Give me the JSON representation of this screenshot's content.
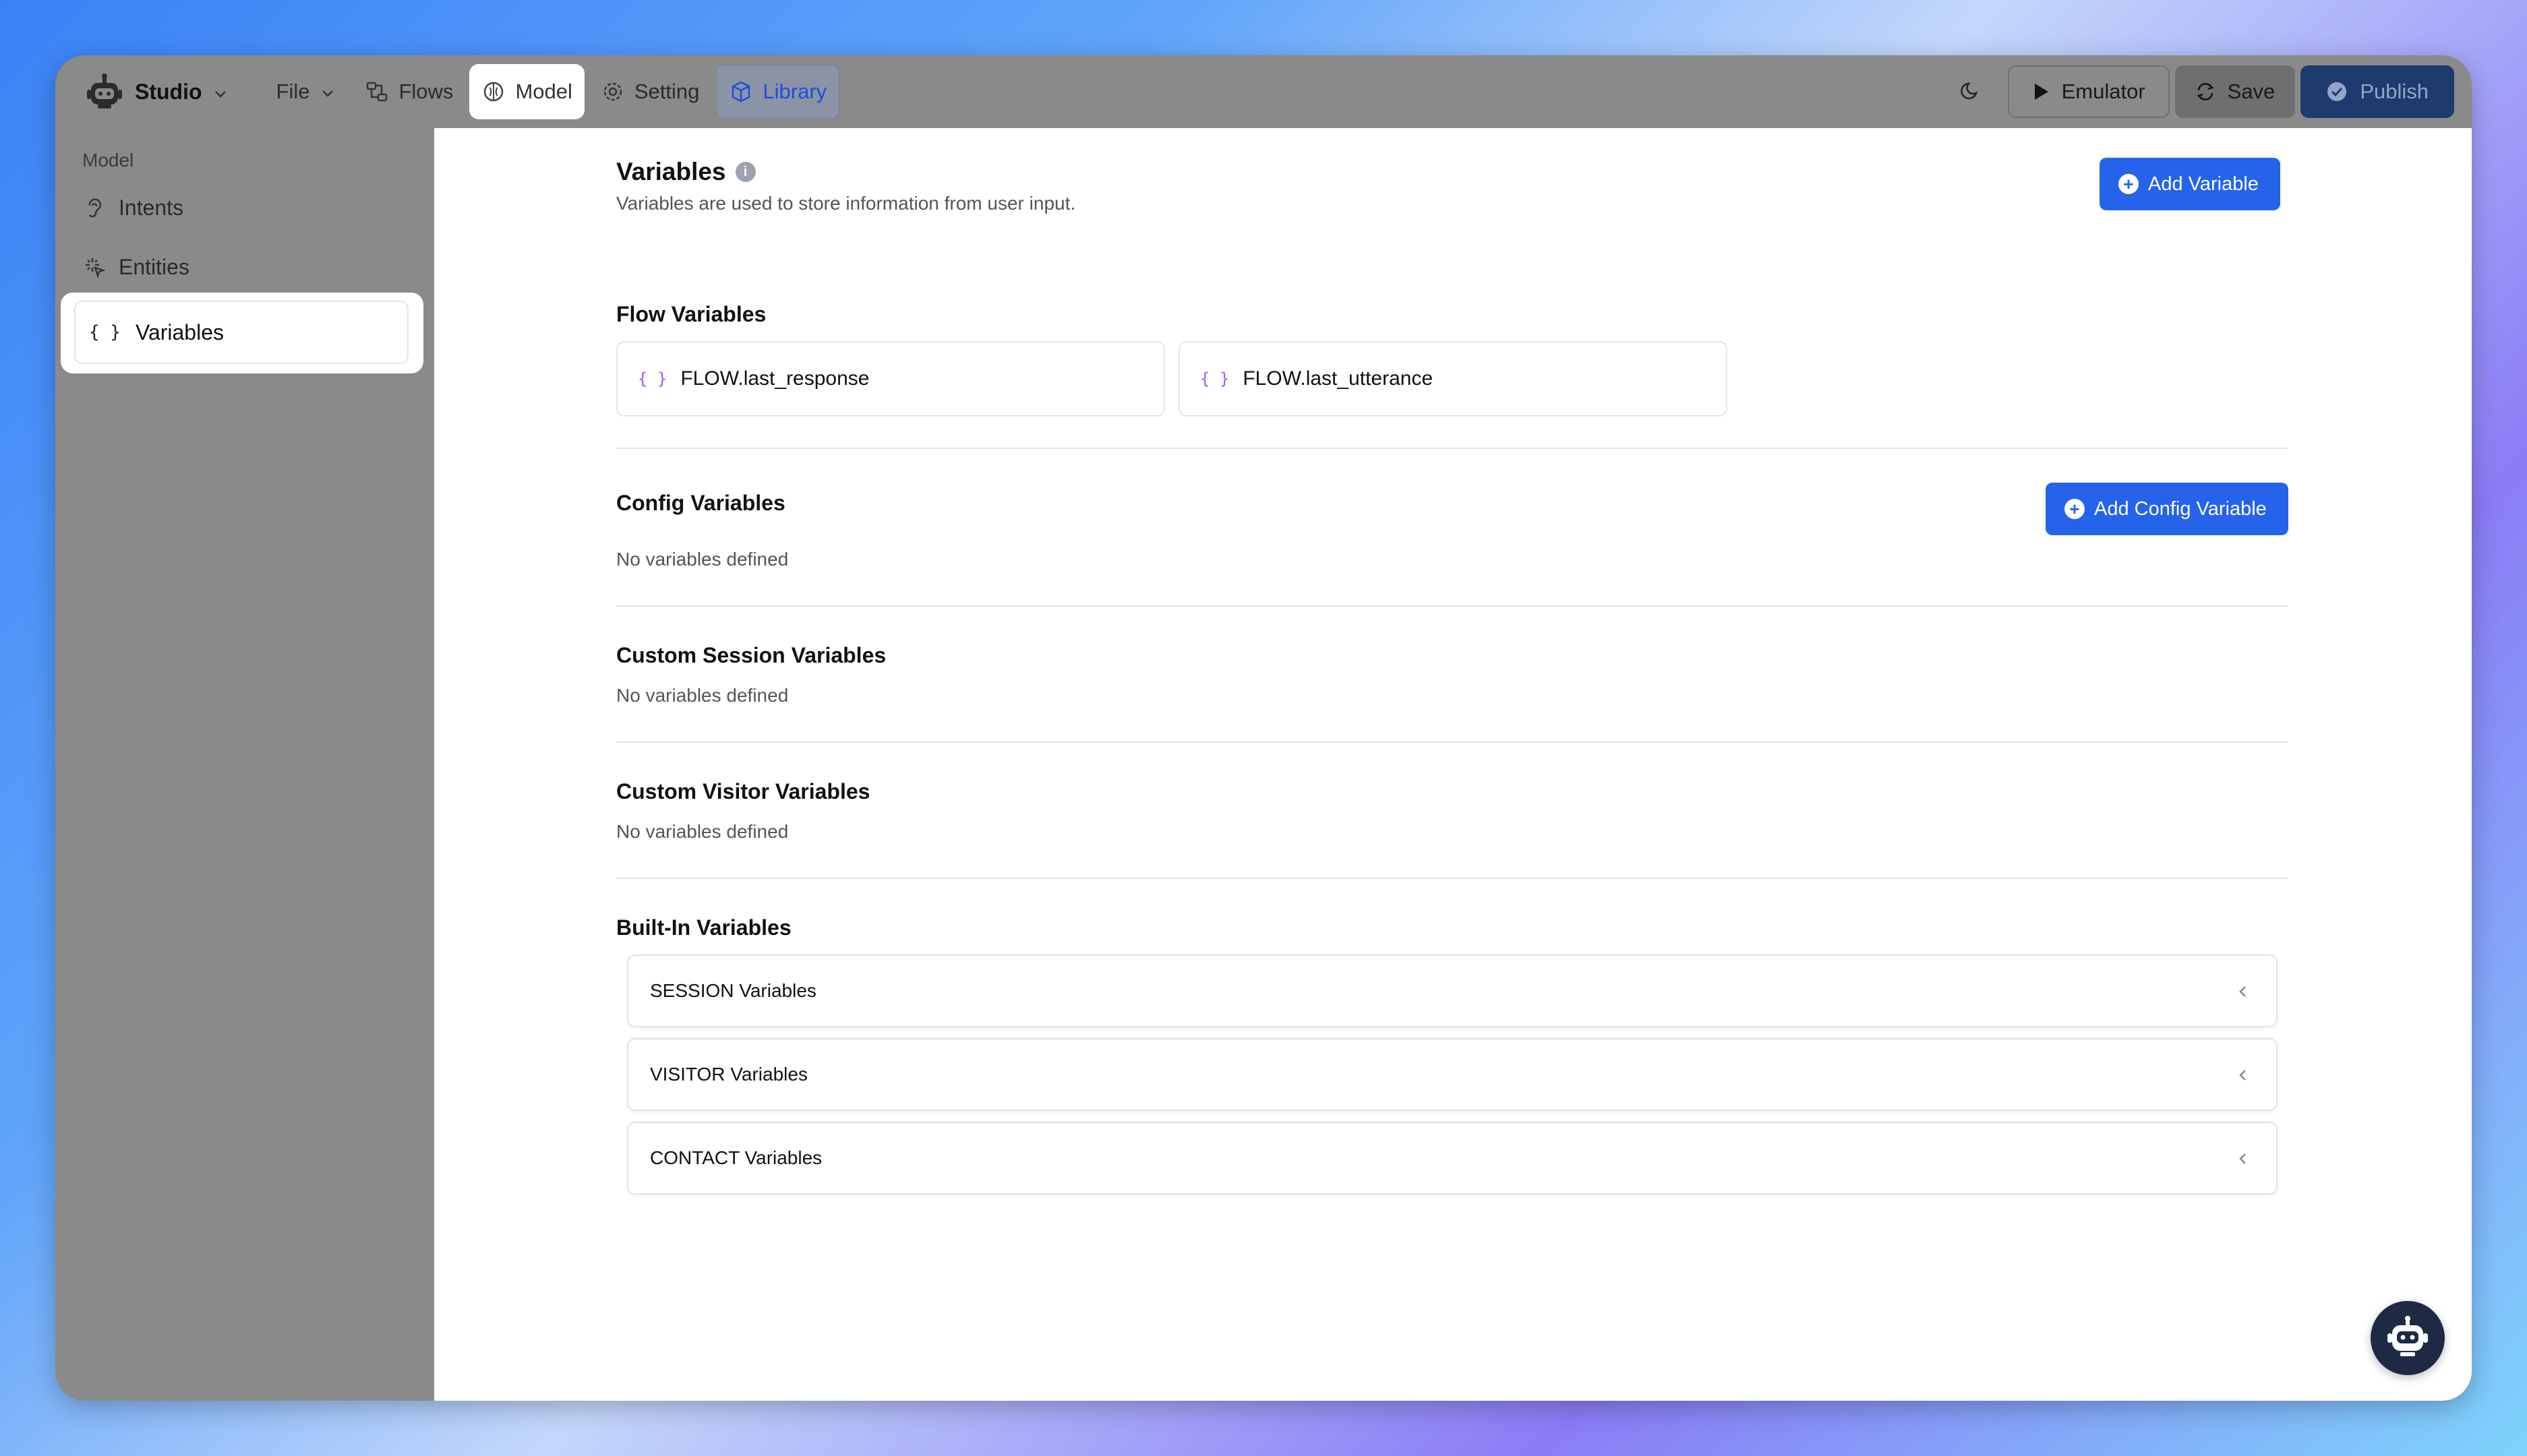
{
  "topbar": {
    "app_name": "Studio",
    "menu": [
      "File",
      "Flows",
      "Model",
      "Setting",
      "Library"
    ],
    "emulator_label": "Emulator",
    "save_label": "Save",
    "publish_label": "Publish"
  },
  "sidebar": {
    "header": "Model",
    "items": [
      {
        "label": "Intents",
        "icon": "ear-icon"
      },
      {
        "label": "Entities",
        "icon": "sparkle-icon"
      },
      {
        "label": "Variables",
        "icon": "braces-icon"
      }
    ]
  },
  "main": {
    "title": "Variables",
    "subtitle": "Variables are used to store information from user input.",
    "add_variable_label": "Add Variable",
    "flow_variables": {
      "title": "Flow Variables",
      "items": [
        "FLOW.last_response",
        "FLOW.last_utterance"
      ]
    },
    "config_variables": {
      "title": "Config Variables",
      "add_label": "Add Config Variable",
      "empty_text": "No variables defined"
    },
    "custom_session": {
      "title": "Custom Session Variables",
      "empty_text": "No variables defined"
    },
    "custom_visitor": {
      "title": "Custom Visitor Variables",
      "empty_text": "No variables defined"
    },
    "built_in": {
      "title": "Built-In Variables",
      "groups": [
        "SESSION Variables",
        "VISITOR Variables",
        "CONTACT Variables"
      ]
    }
  },
  "colors": {
    "accent": "#2563eb",
    "publish_bg": "#1e3a6e",
    "brace": "#a855f7"
  }
}
